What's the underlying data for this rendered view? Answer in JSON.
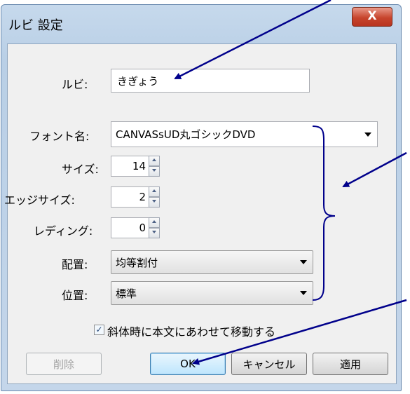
{
  "window": {
    "title": "ルビ 設定",
    "close_label": "X"
  },
  "ruby": {
    "label": "ルビ:",
    "value": "きぎょう"
  },
  "font": {
    "label": "フォント名:",
    "value": "CANVASsUD丸ゴシックDVD"
  },
  "size": {
    "label": "サイズ:",
    "value": "14"
  },
  "edge_size": {
    "label": "エッジサイズ:",
    "value": "2"
  },
  "leading": {
    "label": "レディング:",
    "value": "0"
  },
  "alignment": {
    "label": "配置:",
    "value": "均等割付"
  },
  "position": {
    "label": "位置:",
    "value": "標準"
  },
  "italic_checkbox": {
    "label": "斜体時に本文にあわせて移動する",
    "checked": true,
    "mark": "✓"
  },
  "buttons": {
    "delete": "削除",
    "ok": "OK",
    "cancel": "キャンセル",
    "apply": "適用"
  },
  "annotation_color": "#00008b"
}
